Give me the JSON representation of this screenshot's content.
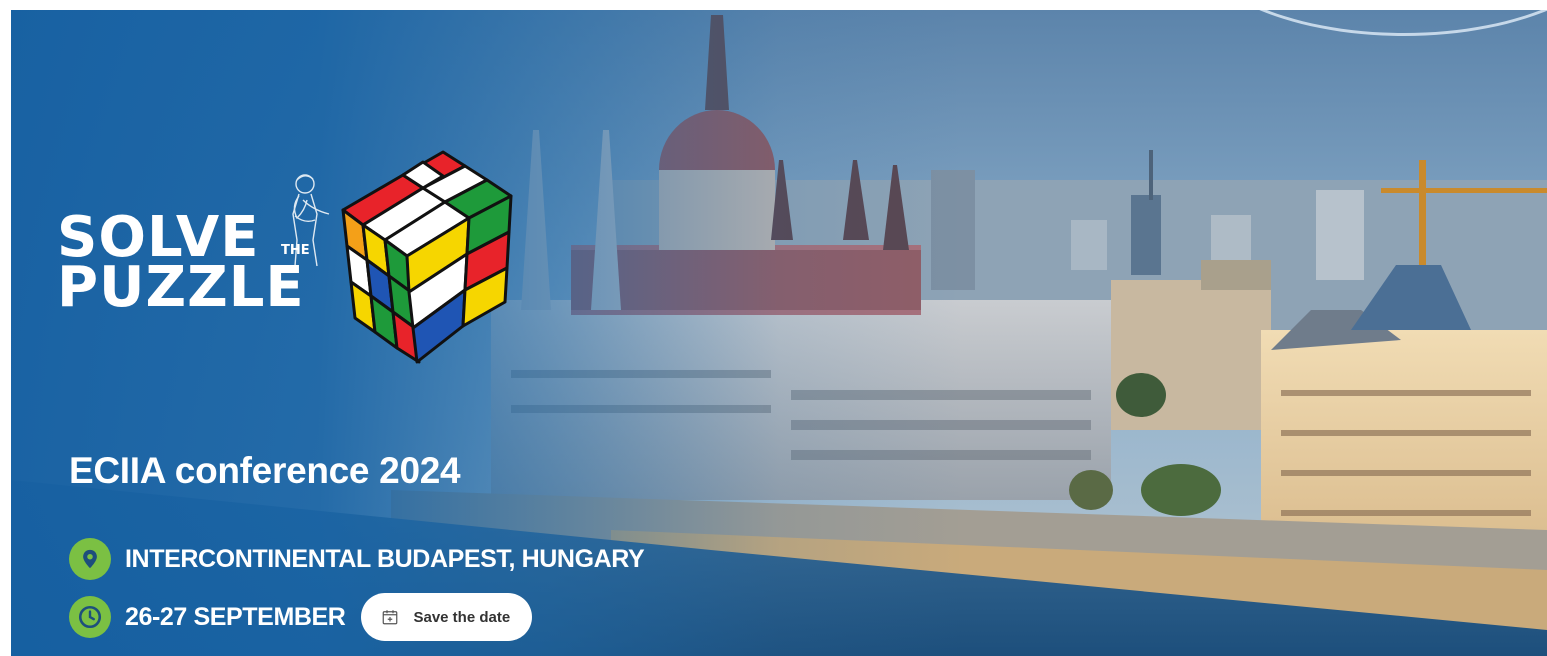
{
  "brand": {
    "word1": "SOLVE",
    "word_small": "THE",
    "word2": "PUZZLE"
  },
  "event": {
    "title": "ECIIA conference 2024",
    "location": "INTERCONTINENTAL BUDAPEST, HUNGARY",
    "date": "26-27 SEPTEMBER",
    "save_label": "Save the date"
  },
  "colors": {
    "banner_blue": "#1660a2",
    "accent_green": "#7bc043",
    "button_bg": "#ffffff"
  },
  "icons": {
    "location": "map-pin-icon",
    "date": "clock-icon",
    "save": "calendar-add-icon"
  }
}
